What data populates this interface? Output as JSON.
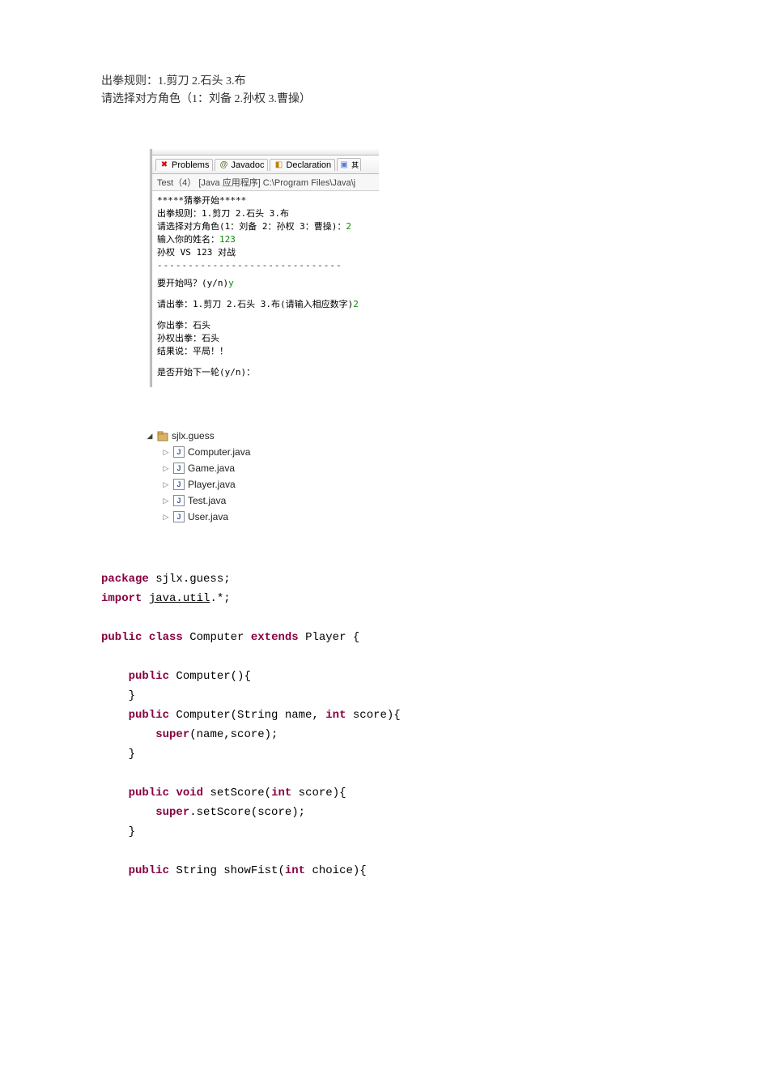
{
  "intro": {
    "line1": "出拳规则：1.剪刀 2.石头 3.布",
    "line2": "请选择对方角色（1：刘备 2.孙权 3.曹操）"
  },
  "tabs": {
    "problems": "Problems",
    "javadoc": "Javadoc",
    "declaration": "Declaration"
  },
  "terminated": "Test（4） [Java 应用程序] C:\\Program Files\\Java\\j",
  "console": {
    "l1": "*****猜拳开始*****",
    "l2": "出拳规则：1.剪刀 2.石头 3.布",
    "l3a": "请选择对方角色(1：刘备 2：孙权 3：曹操)：",
    "l3b": "2",
    "l4a": "输入你的姓名：",
    "l4b": "123",
    "l5": "孙权 VS 123 对战",
    "dash": "------------------------------",
    "l6a": "要开始吗？(y/n)",
    "l6b": "y",
    "l7a": "请出拳：1.剪刀 2.石头 3.布(请输入相应数字)",
    "l7b": "2",
    "l8": "你出拳：石头",
    "l9": "孙权出拳：石头",
    "l10": "结果说：平局！！",
    "l11": "是否开始下一轮(y/n)："
  },
  "tree": {
    "pkg": "sjlx.guess",
    "files": [
      "Computer.java",
      "Game.java",
      "Player.java",
      "Test.java",
      "User.java"
    ]
  },
  "code": {
    "package_kw": "package",
    "package_val": " sjlx.guess;",
    "import_kw": "import",
    "import_val": "java.util",
    "import_tail": ".*;",
    "public_kw": "public",
    "class_kw": "class",
    "class_val": " Computer ",
    "extends_kw": "extends",
    "extends_val": " Player {",
    "ctor1": " Computer(){",
    "brace": "}",
    "ctor2a": " Computer(String name, ",
    "int_kw": "int",
    "ctor2b": " score){",
    "super_kw": "super",
    "super_args1": "(name,score);",
    "void_kw": "void",
    "setscore_a": " setScore(",
    "setscore_b": " score){",
    "super_call2": ".setScore(score);",
    "string_ret": " String showFist(",
    "showfist_b": " choice){"
  }
}
